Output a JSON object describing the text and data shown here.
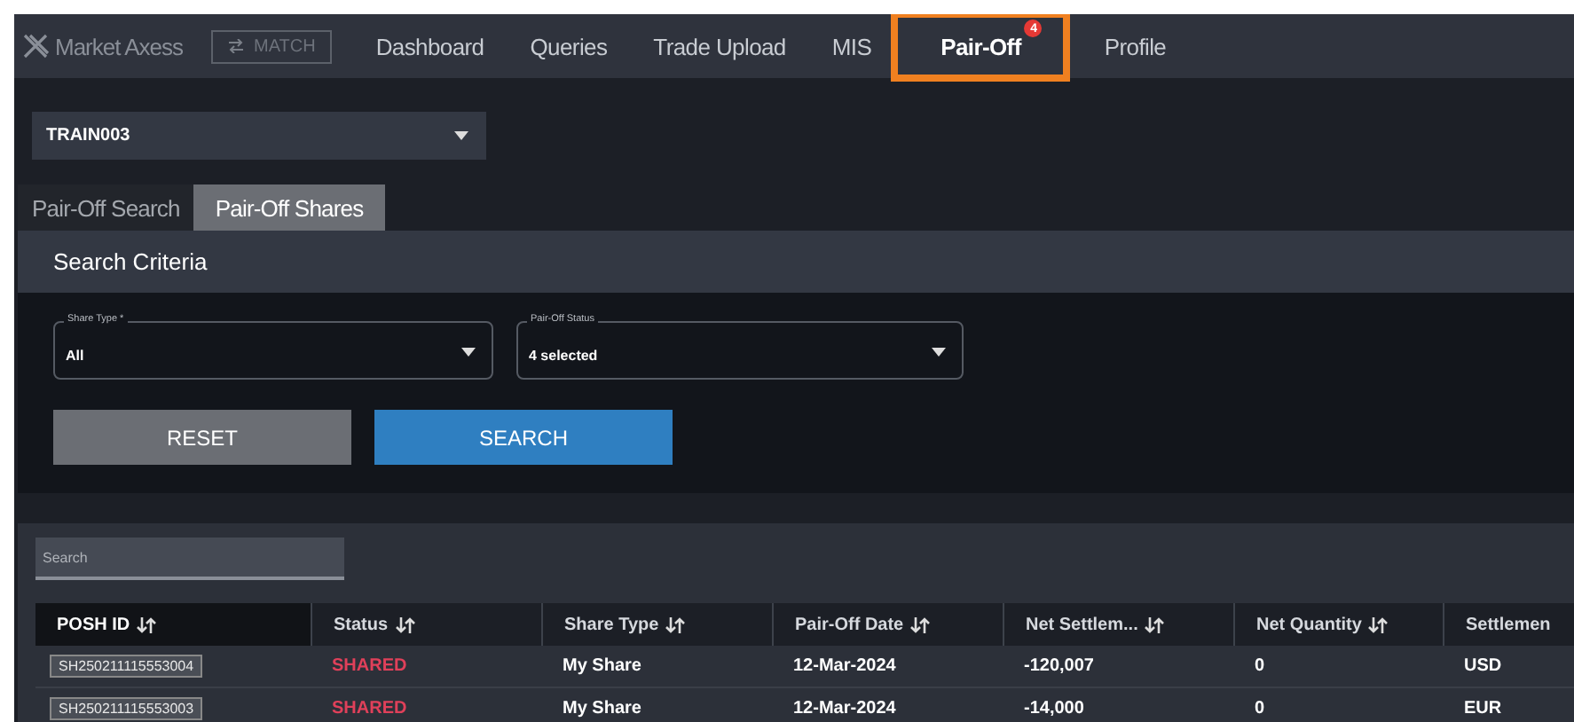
{
  "nav": {
    "logo": "Market Axess",
    "match_button": "MATCH",
    "items": [
      {
        "label": "Dashboard",
        "selected": false
      },
      {
        "label": "Queries",
        "selected": false
      },
      {
        "label": "Trade Upload",
        "selected": false
      },
      {
        "label": "MIS",
        "selected": false
      },
      {
        "label": "Pair-Off",
        "selected": true,
        "badge": "4"
      },
      {
        "label": "Profile",
        "selected": false
      }
    ]
  },
  "account_select": {
    "value": "TRAIN003"
  },
  "tabs": [
    {
      "label": "Pair-Off Search",
      "selected": false
    },
    {
      "label": "Pair-Off Shares",
      "selected": true
    }
  ],
  "search_criteria": {
    "title": "Search Criteria",
    "fields": [
      {
        "label": "Share Type *",
        "value": "All"
      },
      {
        "label": "Pair-Off Status",
        "value": "4 selected"
      }
    ],
    "buttons": [
      {
        "label": "RESET",
        "kind": "secondary"
      },
      {
        "label": "SEARCH",
        "kind": "primary"
      }
    ]
  },
  "table": {
    "search": {
      "placeholder": "Search"
    },
    "columns": [
      {
        "label": "POSH ID",
        "sortable": true
      },
      {
        "label": "Status",
        "sortable": true
      },
      {
        "label": "Share Type",
        "sortable": true
      },
      {
        "label": "Pair-Off Date",
        "sortable": true
      },
      {
        "label": "Net Settlem...",
        "sortable": true
      },
      {
        "label": "Net Quantity",
        "sortable": true
      },
      {
        "label": "Settlemen",
        "sortable": false
      }
    ],
    "rows": [
      [
        "SH250211115553004",
        "SHARED",
        "My Share",
        "12-Mar-2024",
        "-120,007",
        "0",
        "USD"
      ],
      [
        "SH250211115553003",
        "SHARED",
        "My Share",
        "12-Mar-2024",
        "-14,000",
        "0",
        "EUR"
      ]
    ]
  }
}
